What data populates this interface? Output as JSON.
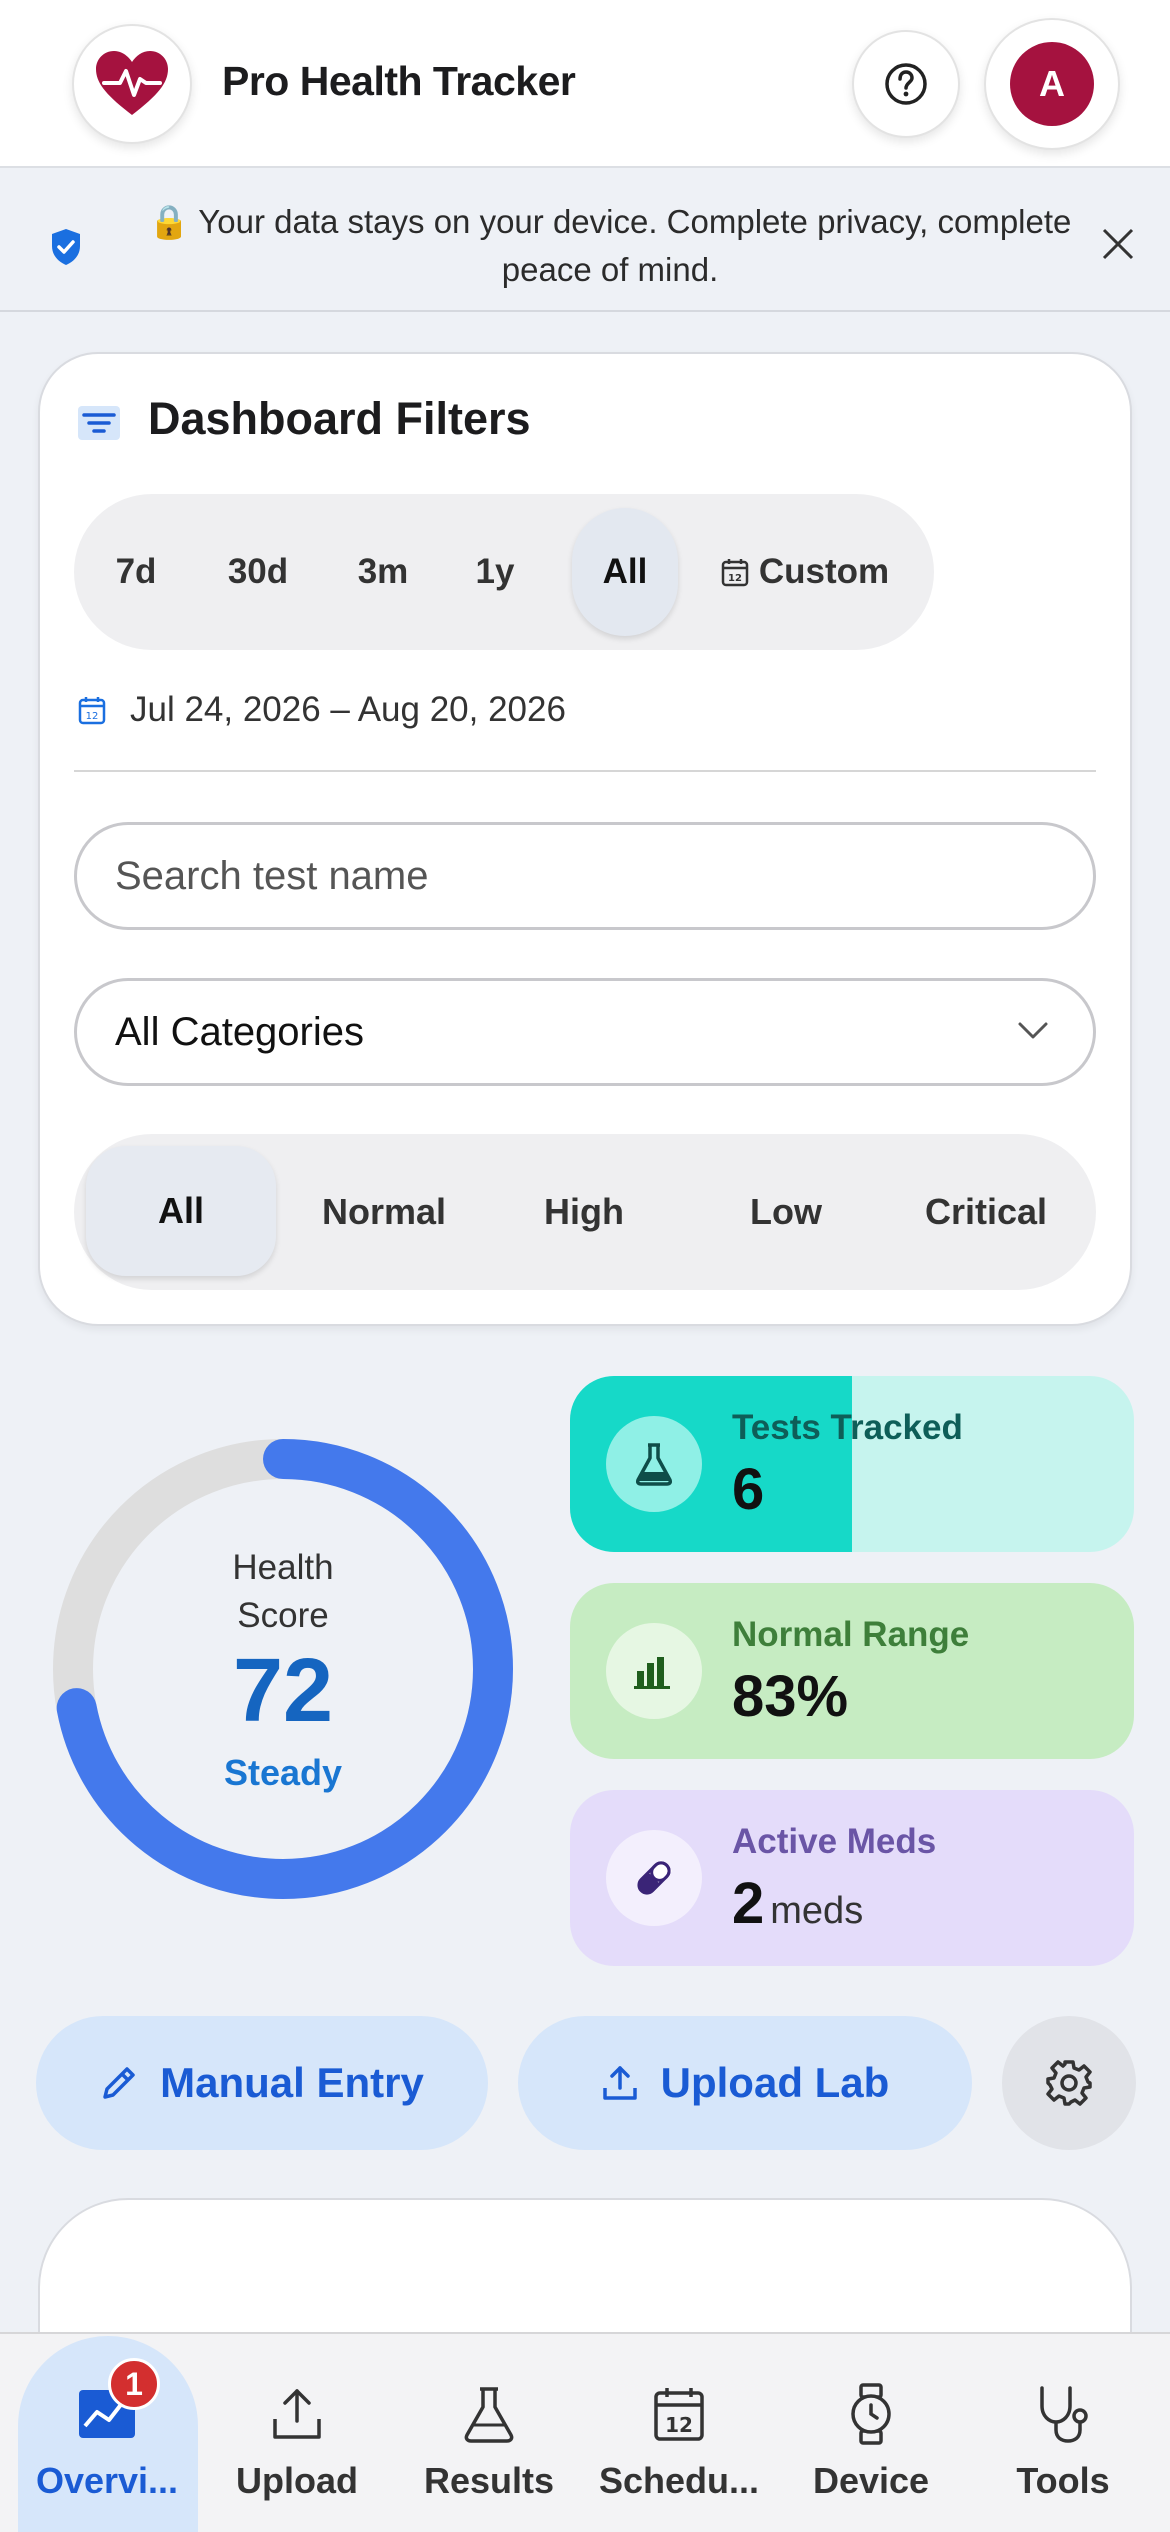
{
  "header": {
    "app_title": "Pro Health Tracker",
    "logo_icon": "heart-pulse-icon",
    "help_icon": "help-circle-icon",
    "avatar_initial": "A",
    "avatar_color": "#a5123f"
  },
  "banner": {
    "text": "🔒 Your data stays on your device. Complete privacy, complete peace of mind.",
    "shield_icon": "shield-check-icon",
    "close_icon": "close-icon"
  },
  "filters": {
    "title": "Dashboard Filters",
    "range_options": [
      "7d",
      "30d",
      "3m",
      "1y",
      "All",
      "Custom"
    ],
    "range_selected": "All",
    "date_range": "Jul 24, 2026 – Aug 20, 2026",
    "search_placeholder": "Search test name",
    "category_selected": "All Categories",
    "status_options": [
      "All",
      "Normal",
      "High",
      "Low",
      "Critical"
    ],
    "status_selected": "All"
  },
  "health_score": {
    "label_line1": "Health",
    "label_line2": "Score",
    "value": "72",
    "trend": "Steady",
    "progress_fraction": 0.72,
    "arc_color": "#4479ec"
  },
  "stats": [
    {
      "label": "Tests Tracked",
      "value": "6",
      "unit": "",
      "icon": "flask-icon",
      "fill_fraction": 0.5,
      "color": "#16d9c8"
    },
    {
      "label": "Normal Range",
      "value": "83%",
      "unit": "",
      "icon": "bar-chart-icon",
      "color": "#c6ecc2"
    },
    {
      "label": "Active Meds",
      "value": "2",
      "unit": "meds",
      "icon": "pill-icon",
      "color": "#e4dcfa"
    }
  ],
  "actions": {
    "manual_entry": "Manual Entry",
    "upload_lab": "Upload Lab",
    "settings_icon": "gear-icon"
  },
  "bottom_nav": {
    "items": [
      {
        "label": "Overvi...",
        "icon": "chart-line-icon"
      },
      {
        "label": "Upload",
        "icon": "upload-icon"
      },
      {
        "label": "Results",
        "icon": "flask-icon"
      },
      {
        "label": "Schedu...",
        "icon": "calendar-icon"
      },
      {
        "label": "Device",
        "icon": "watch-icon"
      },
      {
        "label": "Tools",
        "icon": "stethoscope-icon"
      }
    ],
    "badge_count": "1",
    "active_index": 0
  }
}
